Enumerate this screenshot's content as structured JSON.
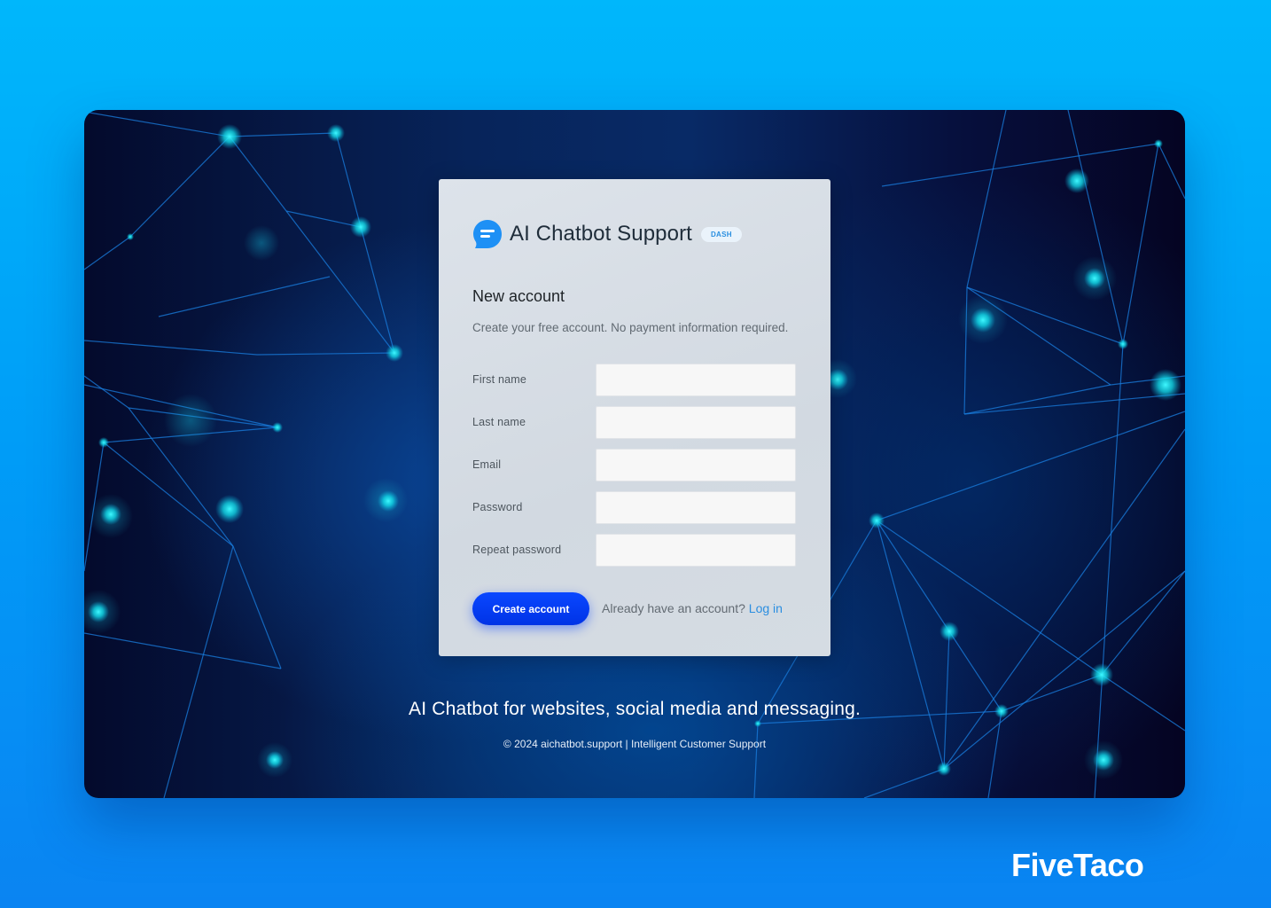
{
  "brand": {
    "name": "AI Chatbot Support",
    "badge": "DASH",
    "icon": "chat-bubble-icon",
    "accent_color": "#1e90f5"
  },
  "form": {
    "title": "New account",
    "subtitle": "Create your free account. No payment information required.",
    "fields": [
      {
        "label": "First name",
        "value": "",
        "placeholder": ""
      },
      {
        "label": "Last name",
        "value": "",
        "placeholder": ""
      },
      {
        "label": "Email",
        "value": "",
        "placeholder": ""
      },
      {
        "label": "Password",
        "value": "",
        "placeholder": ""
      },
      {
        "label": "Repeat password",
        "value": "",
        "placeholder": ""
      }
    ],
    "submit_label": "Create account",
    "login_prompt": "Already have an account?",
    "login_link": "Log in",
    "button_color": "#0a40ff",
    "link_color": "#2b8ee0"
  },
  "footer": {
    "tagline": "AI Chatbot for websites, social media and messaging.",
    "copyright": "© 2024 aichatbot.support | Intelligent Customer Support"
  },
  "watermark": {
    "text": "FiveTaco"
  }
}
